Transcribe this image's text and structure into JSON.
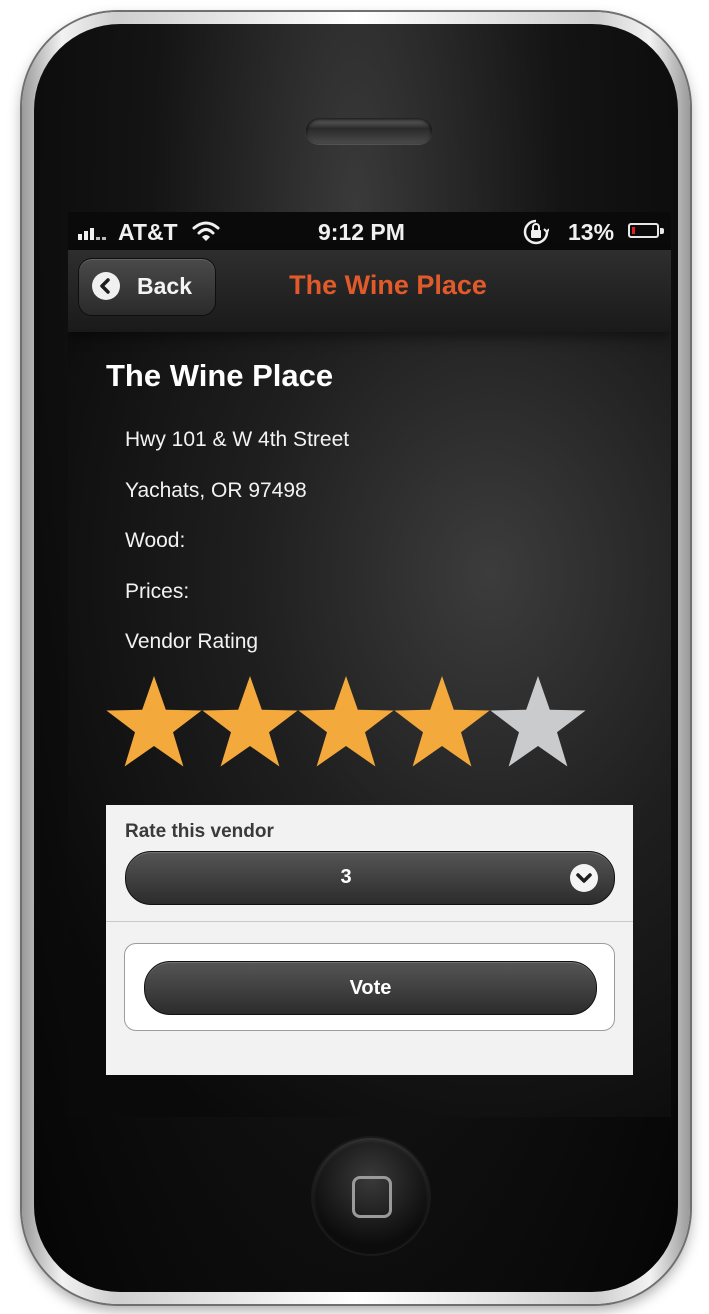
{
  "status_bar": {
    "carrier": "AT&T",
    "time": "9:12 PM",
    "battery_percent": "13%",
    "battery_level": 0.13,
    "icons": [
      "signal-icon",
      "wifi-icon",
      "orientation-lock-icon",
      "battery-icon"
    ]
  },
  "nav": {
    "back_label": "Back",
    "title": "The Wine Place",
    "title_color": "#e25a2a"
  },
  "vendor": {
    "name": "The Wine Place",
    "address": "Hwy 101 & W 4th Street",
    "city": "Yachats, OR 97498",
    "wood_label": "Wood:",
    "prices_label": "Prices:",
    "rating_label": "Vendor Rating",
    "rating": 4,
    "rating_max": 5,
    "star_color_filled": "#f3a93c",
    "star_color_empty": "#c9cbcd"
  },
  "rate_form": {
    "label": "Rate this vendor",
    "selected_value": "3",
    "vote_label": "Vote"
  }
}
